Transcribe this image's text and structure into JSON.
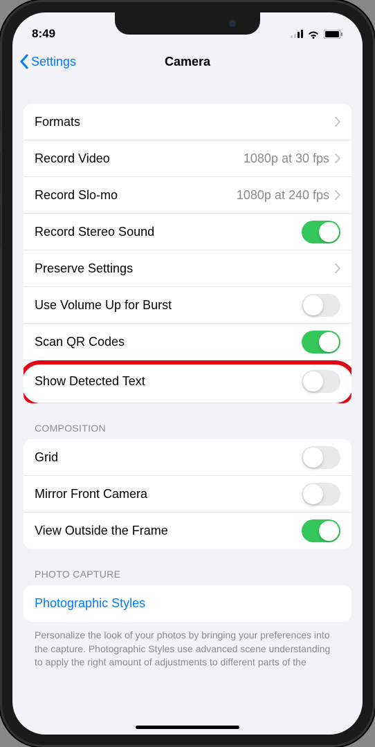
{
  "status": {
    "time": "8:49"
  },
  "nav": {
    "back": "Settings",
    "title": "Camera"
  },
  "group1": {
    "items": [
      {
        "label": "Formats",
        "type": "nav"
      },
      {
        "label": "Record Video",
        "value": "1080p at 30 fps",
        "type": "nav"
      },
      {
        "label": "Record Slo-mo",
        "value": "1080p at 240 fps",
        "type": "nav"
      },
      {
        "label": "Record Stereo Sound",
        "type": "toggle",
        "on": true
      },
      {
        "label": "Preserve Settings",
        "type": "nav"
      },
      {
        "label": "Use Volume Up for Burst",
        "type": "toggle",
        "on": false
      },
      {
        "label": "Scan QR Codes",
        "type": "toggle",
        "on": true
      },
      {
        "label": "Show Detected Text",
        "type": "toggle",
        "on": false
      }
    ]
  },
  "group2": {
    "header": "COMPOSITION",
    "items": [
      {
        "label": "Grid",
        "type": "toggle",
        "on": false
      },
      {
        "label": "Mirror Front Camera",
        "type": "toggle",
        "on": false
      },
      {
        "label": "View Outside the Frame",
        "type": "toggle",
        "on": true
      }
    ]
  },
  "group3": {
    "header": "PHOTO CAPTURE",
    "items": [
      {
        "label": "Photographic Styles",
        "type": "link"
      }
    ],
    "footer": "Personalize the look of your photos by bringing your preferences into the capture. Photographic Styles use advanced scene understanding to apply the right amount of adjustments to different parts of the"
  }
}
